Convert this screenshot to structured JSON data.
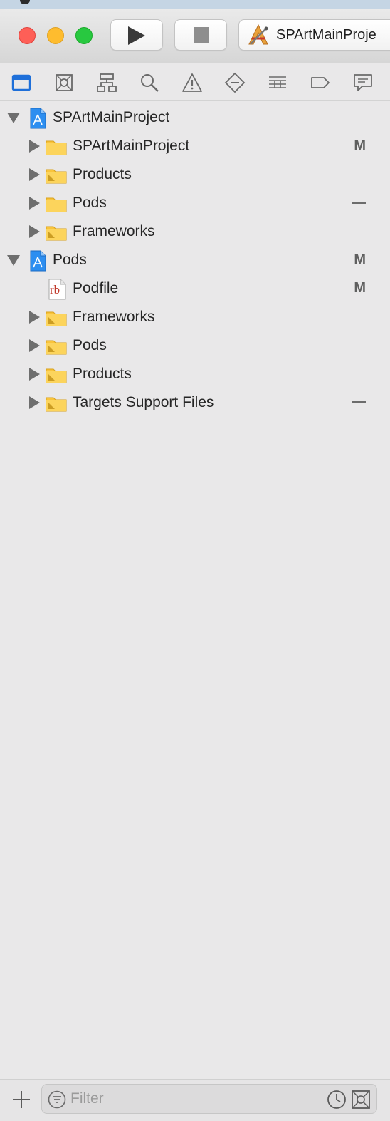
{
  "window": {
    "traffic_lights": [
      "close",
      "minimize",
      "zoom"
    ],
    "run_icon": "play-icon",
    "stop_icon": "stop-icon",
    "scheme": {
      "icon": "xcode-app-icon",
      "label": "SPArtMainProje"
    }
  },
  "navigator_tabs": [
    {
      "icon": "folder-navigator-icon",
      "selected": true
    },
    {
      "icon": "source-control-icon",
      "selected": false
    },
    {
      "icon": "symbol-hierarchy-icon",
      "selected": false
    },
    {
      "icon": "search-icon",
      "selected": false
    },
    {
      "icon": "warning-icon",
      "selected": false
    },
    {
      "icon": "test-diamond-icon",
      "selected": false
    },
    {
      "icon": "debug-list-icon",
      "selected": false
    },
    {
      "icon": "breakpoint-icon",
      "selected": false
    },
    {
      "icon": "report-icon",
      "selected": false
    }
  ],
  "tree": [
    {
      "label": "SPArtMainProject",
      "type": "project",
      "level": 0,
      "expanded": true,
      "status": ""
    },
    {
      "label": "SPArtMainProject",
      "type": "folder",
      "level": 1,
      "expanded": false,
      "status": "M"
    },
    {
      "label": "Products",
      "type": "group",
      "level": 1,
      "expanded": false,
      "status": ""
    },
    {
      "label": "Pods",
      "type": "folder",
      "level": 1,
      "expanded": false,
      "status": "—"
    },
    {
      "label": "Frameworks",
      "type": "group",
      "level": 1,
      "expanded": false,
      "status": ""
    },
    {
      "label": "Pods",
      "type": "project",
      "level": 0,
      "expanded": true,
      "status": "M"
    },
    {
      "label": "Podfile",
      "type": "file",
      "level": 1,
      "expanded": null,
      "status": "M",
      "file_badge": "rb"
    },
    {
      "label": "Frameworks",
      "type": "group",
      "level": 1,
      "expanded": false,
      "status": ""
    },
    {
      "label": "Pods",
      "type": "group",
      "level": 1,
      "expanded": false,
      "status": ""
    },
    {
      "label": "Products",
      "type": "group",
      "level": 1,
      "expanded": false,
      "status": ""
    },
    {
      "label": "Targets Support Files",
      "type": "group",
      "level": 1,
      "expanded": false,
      "status": "—"
    }
  ],
  "bottom_bar": {
    "add_icon": "plus-icon",
    "filter_placeholder": "Filter",
    "filter_value": "",
    "filter_icon": "filter-icon",
    "recent_icon": "clock-icon",
    "scope_icon": "scope-icon"
  },
  "colors": {
    "accent": "#1e6fd9",
    "folder": "#f9c43c",
    "close": "#fe5f57",
    "minimize": "#febc2e",
    "zoom": "#28c840"
  }
}
